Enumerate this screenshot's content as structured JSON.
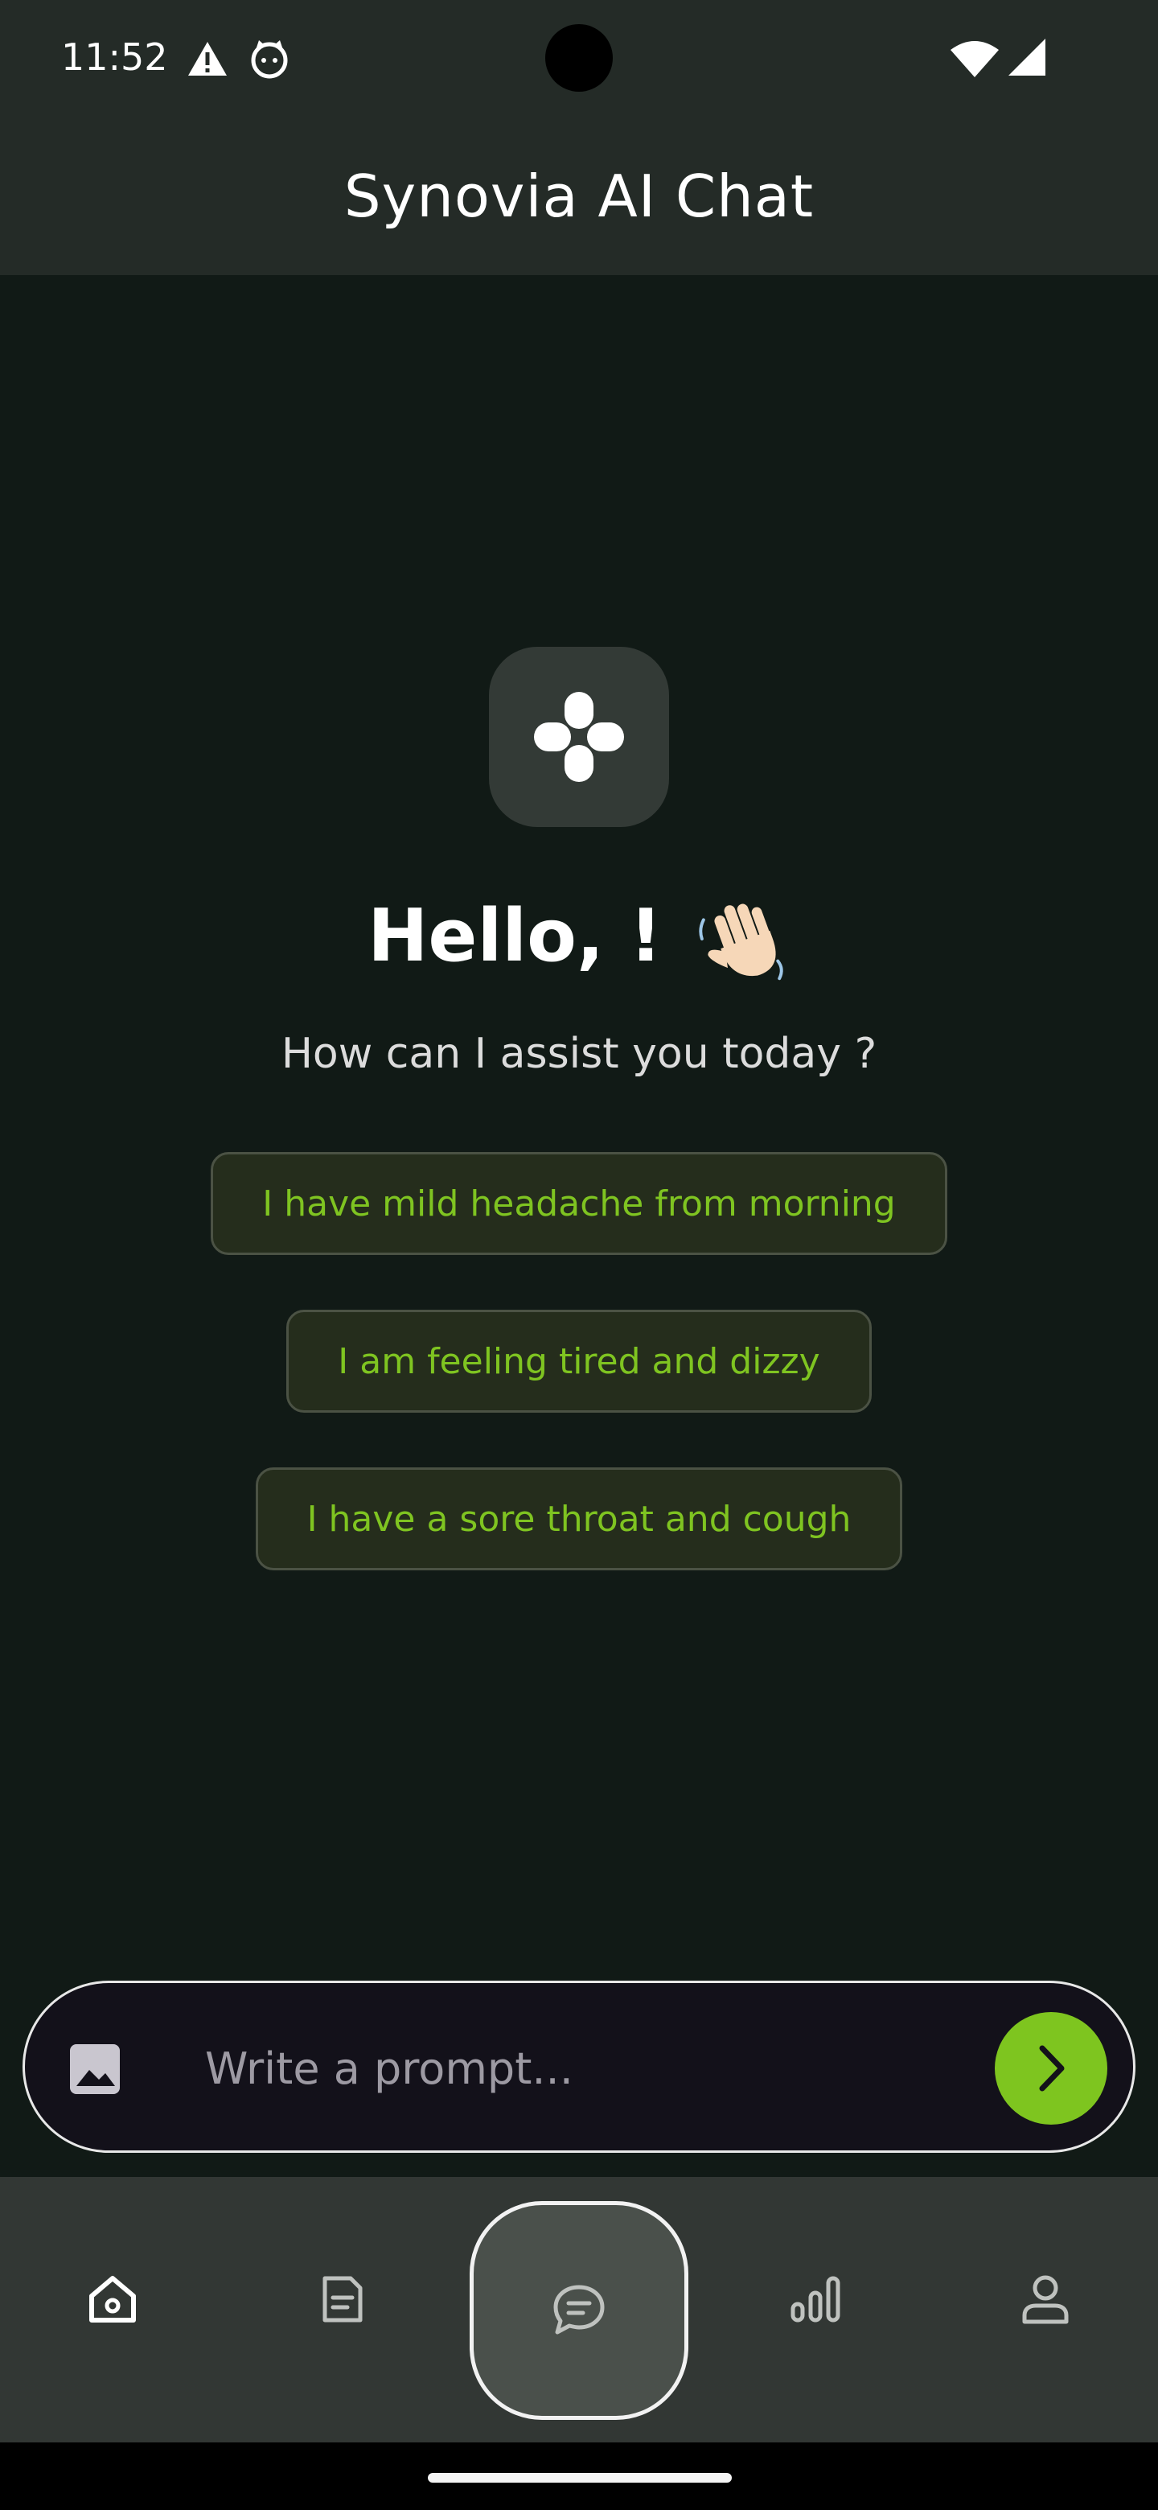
{
  "status_bar": {
    "time": "11:52",
    "icons": [
      "warning-icon",
      "cat-notification-icon",
      "wifi-icon",
      "cell-signal-icon"
    ]
  },
  "header": {
    "title": "Synovia AI Chat"
  },
  "main": {
    "logo_icon": "sparkle-plus-icon",
    "greeting": "Hello,  !",
    "greeting_emoji": "waving-hand-icon",
    "subtitle": "How can I assist you today ?",
    "suggestions": [
      "I have mild headache from morning",
      "I am feeling tired and dizzy",
      "I have a sore throat and cough"
    ]
  },
  "prompt": {
    "placeholder": "Write a prompt...",
    "value": "",
    "attach_icon": "image-icon",
    "send_icon": "chevron-right-icon"
  },
  "bottom_nav": {
    "items": [
      "home-icon",
      "document-icon",
      "chat-icon",
      "stats-icon",
      "profile-icon"
    ],
    "active": "chat"
  },
  "colors": {
    "background": "#111a16",
    "header": "#242b27",
    "accent": "#7ec51f",
    "chip_background": "#252d1c",
    "nav_background": "#323734"
  }
}
